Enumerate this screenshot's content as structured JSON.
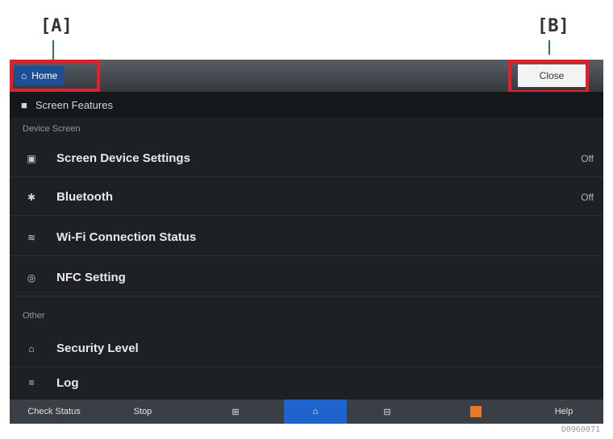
{
  "callouts": {
    "a": "[A]",
    "b": "[B]"
  },
  "topbar": {
    "back_label": "Home",
    "close_label": "Close"
  },
  "header": {
    "label": "Screen Features"
  },
  "sections": [
    "Device Screen",
    "Other"
  ],
  "items": [
    {
      "icon": "display-icon",
      "glyph": "▣",
      "label": "Screen Device Settings",
      "value": "Off"
    },
    {
      "icon": "bluetooth-icon",
      "glyph": "✱",
      "label": "Bluetooth",
      "value": "Off"
    },
    {
      "icon": "wifi-icon",
      "glyph": "≋",
      "label": "Wi-Fi Connection Status",
      "value": ""
    },
    {
      "icon": "nfc-icon",
      "glyph": "◎",
      "label": "NFC Setting",
      "value": ""
    },
    {
      "icon": "lock-icon",
      "glyph": "⌂",
      "label": "Security Level",
      "value": ""
    },
    {
      "icon": "list-icon",
      "glyph": "≡",
      "label": "Log",
      "value": ""
    }
  ],
  "bottom_bar": [
    {
      "icon": "status-icon",
      "label": "Check Status"
    },
    {
      "icon": "stop-icon",
      "label": "Stop"
    },
    {
      "icon": "menu-icon",
      "label": "⊞"
    },
    {
      "icon": "home-icon",
      "label": "⌂"
    },
    {
      "icon": "apps-icon",
      "label": "⊟"
    },
    {
      "icon": "alert-icon",
      "label": ""
    },
    {
      "icon": "help-icon",
      "label": "Help"
    }
  ],
  "colors": {
    "callout_red": "#e0202a",
    "accent_blue": "#1f63cc",
    "background": "#1d2126",
    "alert_orange": "#e7782a"
  },
  "footnote": "D0960071"
}
